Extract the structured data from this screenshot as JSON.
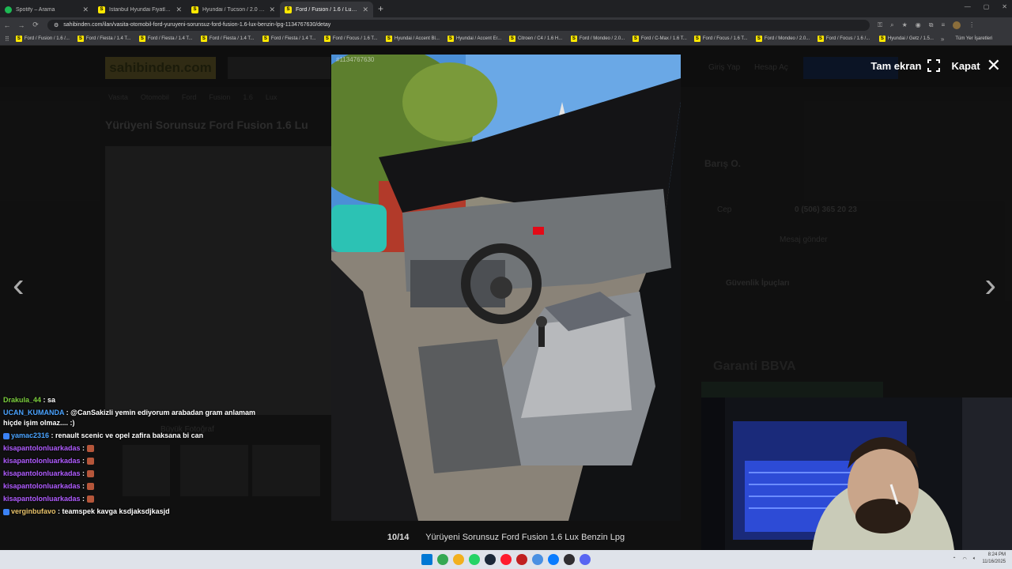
{
  "browser": {
    "tabs": [
      {
        "title": "Spotify – Arama",
        "color": "#1db954",
        "letter": "",
        "active": false
      },
      {
        "title": "İstanbul Hyundai Fiyatları & M",
        "color": "#ffe800",
        "letter": "S",
        "active": false
      },
      {
        "title": "Hyundai / Tucson / 2.0 CRDI / 2",
        "color": "#ffe800",
        "letter": "S",
        "active": false
      },
      {
        "title": "Ford / Fusion / 1.6 / Lux / Yürü",
        "color": "#ffe800",
        "letter": "S",
        "active": true
      }
    ],
    "url": "sahibinden.com/ilan/vasita-otomobil-ford-yuruyeni-sorunsuz-ford-fusion-1.6-lux-benzin-lpg-1134767630/detay",
    "bookmarks": [
      "Ford / Fusion / 1.6 /...",
      "Ford / Fiesta / 1.4 T...",
      "Ford / Fiesta / 1.4 T...",
      "Ford / Fiesta / 1.4 T...",
      "Ford / Fiesta / 1.4 T...",
      "Ford / Focus / 1.6 T...",
      "Hyundai / Accent Bl...",
      "Hyundai / Accent Er...",
      "Citroen / C4 / 1.6 H...",
      "Ford / Mondeo / 2.0...",
      "Ford / C-Max / 1.6 T...",
      "Ford / Focus / 1.6 T...",
      "Ford / Mondeo / 2.0...",
      "Ford / Focus / 1.6 /...",
      "Hyundai / Getz / 1.5..."
    ],
    "bookmarks_all": "Tüm Yer İşaretleri",
    "bookmarks_more": "»"
  },
  "page": {
    "logo": "sahibinden.com",
    "title": "Yürüyeni Sorunsuz Ford Fusion 1.6 Lu",
    "seller": "Barış O.",
    "phone_label": "Cep",
    "phone": "0 (506) 365 20 23",
    "message": "Mesaj gönder",
    "security": "Güvenlik İpuçları",
    "bank": "Garanti BBVA",
    "big_photo": "Büyük Fotoğraf",
    "login": "Giriş Yap",
    "register": "Hesap Aç",
    "breadcrumb": [
      "Vasıta",
      "Otomobil",
      "Ford",
      "Fusion",
      "1.6",
      "Lux"
    ]
  },
  "lightbox": {
    "photo_id": "#1134767630",
    "fullscreen_label": "Tam ekran",
    "close_label": "Kapat",
    "counter": "10/14",
    "caption": "Yürüyeni Sorunsuz Ford Fusion 1.6 Lux Benzin Lpg",
    "prev_arrow": "‹",
    "next_arrow": "›"
  },
  "chat": [
    {
      "user": "Drakula_44",
      "color": "#7ccf3d",
      "text": " : sa",
      "badge": false,
      "emotes": 0
    },
    {
      "user": "UCAN_KUMANDA",
      "color": "#4aa3ff",
      "text": " : @CanSakizli yemin ediyorum arabadan gram anlamam hiçde işim olmaz.... :)",
      "badge": false,
      "emotes": 0
    },
    {
      "user": "yamac2316",
      "color": "#4aa3ff",
      "text": " : renault scenic ve opel zafira baksana bi can",
      "badge": true,
      "emotes": 0
    },
    {
      "user": "kisapantolonluarkadas",
      "color": "#b05cff",
      "text": " : ",
      "badge": false,
      "emotes": 1
    },
    {
      "user": "kisapantolonluarkadas",
      "color": "#b05cff",
      "text": " : ",
      "badge": false,
      "emotes": 1
    },
    {
      "user": "kisapantolonluarkadas",
      "color": "#b05cff",
      "text": " : ",
      "badge": false,
      "emotes": 1
    },
    {
      "user": "kisapantolonluarkadas",
      "color": "#b05cff",
      "text": " : ",
      "badge": false,
      "emotes": 1
    },
    {
      "user": "kisapantolonluarkadas",
      "color": "#b05cff",
      "text": " : ",
      "badge": false,
      "emotes": 1
    },
    {
      "user": "verginbufavo",
      "color": "#e8c26a",
      "text": " : teamspek kavga ksdjaksdjkasjd",
      "badge": true,
      "emotes": 0
    }
  ],
  "taskbar": {
    "time": "8:24 PM",
    "date": "11/16/2025",
    "icons": [
      "windows-icon",
      "chrome-icon",
      "folder-icon",
      "whatsapp-icon",
      "steam-icon",
      "opera-icon",
      "game-icon",
      "app-icon",
      "edge-icon",
      "obs-icon",
      "discord-icon"
    ]
  }
}
